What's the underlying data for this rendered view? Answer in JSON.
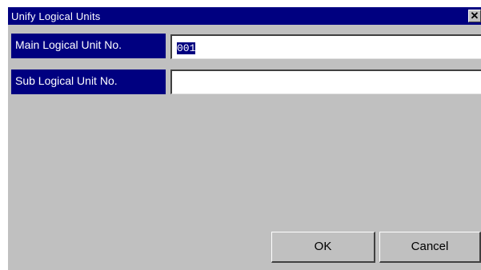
{
  "dialog": {
    "title": "Unify Logical Units",
    "close_symbol": "✕"
  },
  "fields": {
    "main_label": "Main Logical Unit No.",
    "main_value": "001",
    "sub_label": "Sub Logical Unit No.",
    "sub_value": ""
  },
  "buttons": {
    "ok_label": "OK",
    "cancel_label": "Cancel"
  },
  "colors": {
    "titlebar": "#000080",
    "label_bg": "#000080",
    "dialog_bg": "#c0c0c0",
    "selection": "#000080"
  }
}
